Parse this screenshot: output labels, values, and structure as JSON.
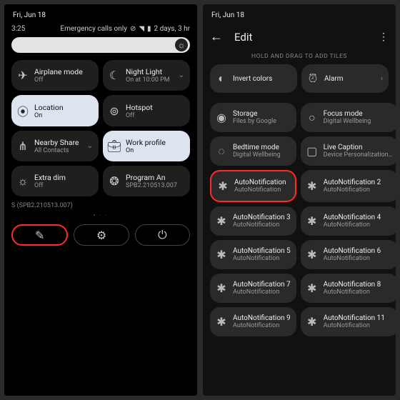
{
  "left": {
    "date": "Fri, Jun 18",
    "time": "3:25",
    "status_right": "Emergency calls only",
    "status_extra": "2 days, 3 hr",
    "tiles": [
      {
        "title": "Airplane mode",
        "sub": "Off"
      },
      {
        "title": "Night Light",
        "sub": "On at 10:00 PM"
      },
      {
        "title": "Location",
        "sub": "On"
      },
      {
        "title": "Hotspot",
        "sub": "Off"
      },
      {
        "title": "Nearby Share",
        "sub": "All Contacts"
      },
      {
        "title": "Work profile",
        "sub": "On"
      },
      {
        "title": "Extra dim",
        "sub": "Off"
      },
      {
        "title": "Program      An",
        "sub": "SPB2.210513.007"
      }
    ],
    "footer": "S (SPB2.210513.007)"
  },
  "right": {
    "date": "Fri, Jun 18",
    "title": "Edit",
    "hold_text": "HOLD AND DRAG TO ADD TILES",
    "head_tiles": [
      {
        "title": "Invert colors",
        "sub": ""
      },
      {
        "title": "Alarm",
        "sub": ""
      }
    ],
    "tiles": [
      {
        "title": "Storage",
        "sub": "Files by Google"
      },
      {
        "title": "Focus mode",
        "sub": "Digital Wellbeing"
      },
      {
        "title": "Bedtime mode",
        "sub": "Digital Wellbeing"
      },
      {
        "title": "Live Caption",
        "sub": "Device Personalization…"
      },
      {
        "title": "AutoNotification",
        "sub": "AutoNotification"
      },
      {
        "title": "AutoNotification 2",
        "sub": "AutoNotification"
      },
      {
        "title": "AutoNotification 3",
        "sub": "AutoNotification"
      },
      {
        "title": "AutoNotification 4",
        "sub": "AutoNotification"
      },
      {
        "title": "AutoNotification 5",
        "sub": "AutoNotification"
      },
      {
        "title": "AutoNotification 6",
        "sub": "AutoNotification"
      },
      {
        "title": "AutoNotification 7",
        "sub": "AutoNotification"
      },
      {
        "title": "AutoNotification 8",
        "sub": "AutoNotification"
      },
      {
        "title": "AutoNotification 9",
        "sub": "AutoNotification"
      },
      {
        "title": "AutoNotification 11",
        "sub": "AutoNotification"
      }
    ]
  }
}
